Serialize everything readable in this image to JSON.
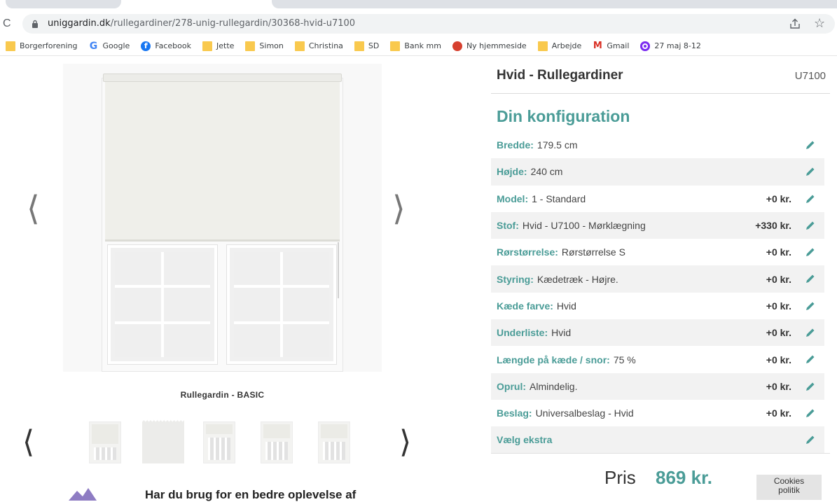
{
  "browser": {
    "reload_icon": "reload-icon",
    "url_domain": "uniggardin.dk",
    "url_path": "/rullegardiner/278-unig-rullegardin/30368-hvid-u7100",
    "reload_glyph": "C",
    "star_glyph": "☆"
  },
  "bookmarks": [
    {
      "label": "Borgerforening",
      "icon": "folder"
    },
    {
      "label": "Google",
      "icon": "google",
      "glyph": "G"
    },
    {
      "label": "Facebook",
      "icon": "facebook",
      "glyph": "f"
    },
    {
      "label": "Jette",
      "icon": "folder"
    },
    {
      "label": "Simon",
      "icon": "folder"
    },
    {
      "label": "Christina",
      "icon": "folder"
    },
    {
      "label": "SD",
      "icon": "folder"
    },
    {
      "label": "Bank mm",
      "icon": "folder"
    },
    {
      "label": "Ny hjemmeside",
      "icon": "site"
    },
    {
      "label": "Arbejde",
      "icon": "folder"
    },
    {
      "label": "Gmail",
      "icon": "gmail",
      "glyph": "M"
    },
    {
      "label": "27 maj 8-12",
      "icon": "calendar"
    }
  ],
  "gallery": {
    "prev_glyph": "⟨",
    "next_glyph": "⟩",
    "caption": "Rullegardin - BASIC",
    "thumb_prev_glyph": "⟨",
    "thumb_next_glyph": "⟩",
    "teaser": "Har du brug for en bedre oplevelse af"
  },
  "product": {
    "title": "Hvid - Rullegardiner",
    "sku": "U7100"
  },
  "configuration": {
    "title": "Din konfiguration",
    "rows": [
      {
        "label": "Bredde:",
        "value": "179.5 cm",
        "price": ""
      },
      {
        "label": "Højde:",
        "value": "240 cm",
        "price": ""
      },
      {
        "label": "Model:",
        "value": "1 - Standard",
        "price": "+0 kr."
      },
      {
        "label": "Stof:",
        "value": "Hvid - U7100 - Mørklægning",
        "price": "+330 kr."
      },
      {
        "label": "Rørstørrelse:",
        "value": "Rørstørrelse S",
        "price": "+0 kr."
      },
      {
        "label": "Styring:",
        "value": "Kædetræk - Højre.",
        "price": "+0 kr."
      },
      {
        "label": "Kæde farve:",
        "value": "Hvid",
        "price": "+0 kr."
      },
      {
        "label": "Underliste:",
        "value": "Hvid",
        "price": "+0 kr."
      },
      {
        "label": "Længde på kæde / snor:",
        "value": "75 %",
        "price": "+0 kr."
      },
      {
        "label": "Oprul:",
        "value": "Almindelig.",
        "price": "+0 kr."
      },
      {
        "label": "Beslag:",
        "value": "Universalbeslag - Hvid",
        "price": "+0 kr."
      },
      {
        "label": "Vælg ekstra",
        "value": "",
        "price": ""
      }
    ],
    "accent_color": "#4a9c97"
  },
  "price": {
    "label": "Pris",
    "value": "869 kr."
  },
  "cookies": {
    "line1": "Cookies",
    "line2": "politik"
  }
}
